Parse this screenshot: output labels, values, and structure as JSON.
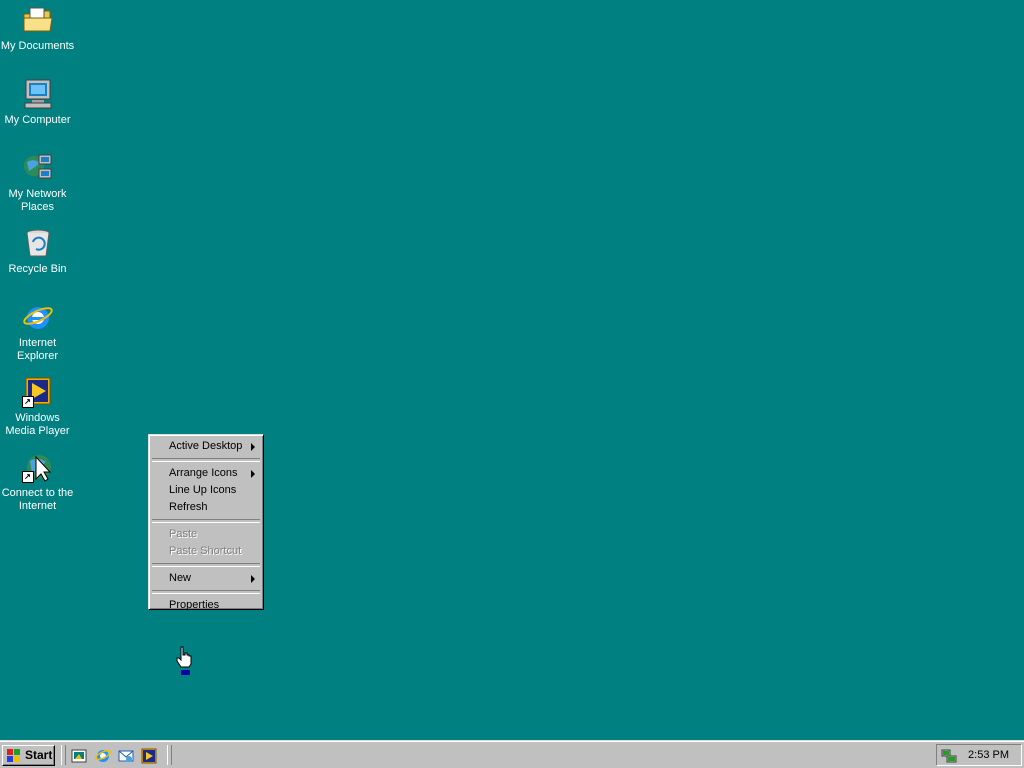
{
  "desktop": {
    "icons": [
      {
        "label": "My Documents",
        "icon": "folder-documents-icon"
      },
      {
        "label": "My Computer",
        "icon": "computer-icon"
      },
      {
        "label": "My Network Places",
        "icon": "network-places-icon"
      },
      {
        "label": "Recycle Bin",
        "icon": "recycle-bin-icon"
      },
      {
        "label": "Internet Explorer",
        "icon": "internet-explorer-icon"
      },
      {
        "label": "Windows Media Player",
        "icon": "media-player-icon"
      },
      {
        "label": "Connect to the Internet",
        "icon": "connect-internet-icon"
      }
    ],
    "background_color": "#008080"
  },
  "context_menu": {
    "items": [
      {
        "label": "Active Desktop",
        "submenu": true,
        "enabled": true
      },
      {
        "label": "Arrange Icons",
        "submenu": true,
        "enabled": true
      },
      {
        "label": "Line Up Icons",
        "enabled": true
      },
      {
        "label": "Refresh",
        "enabled": true
      },
      {
        "label": "Paste",
        "enabled": false
      },
      {
        "label": "Paste Shortcut",
        "enabled": false
      },
      {
        "label": "New",
        "submenu": true,
        "enabled": true
      },
      {
        "label": "Properties",
        "enabled": true
      }
    ]
  },
  "taskbar": {
    "start_label": "Start",
    "quick_launch": [
      "show-desktop-icon",
      "internet-explorer-icon",
      "outlook-express-icon",
      "media-player-icon"
    ],
    "clock": "2:53 PM"
  }
}
